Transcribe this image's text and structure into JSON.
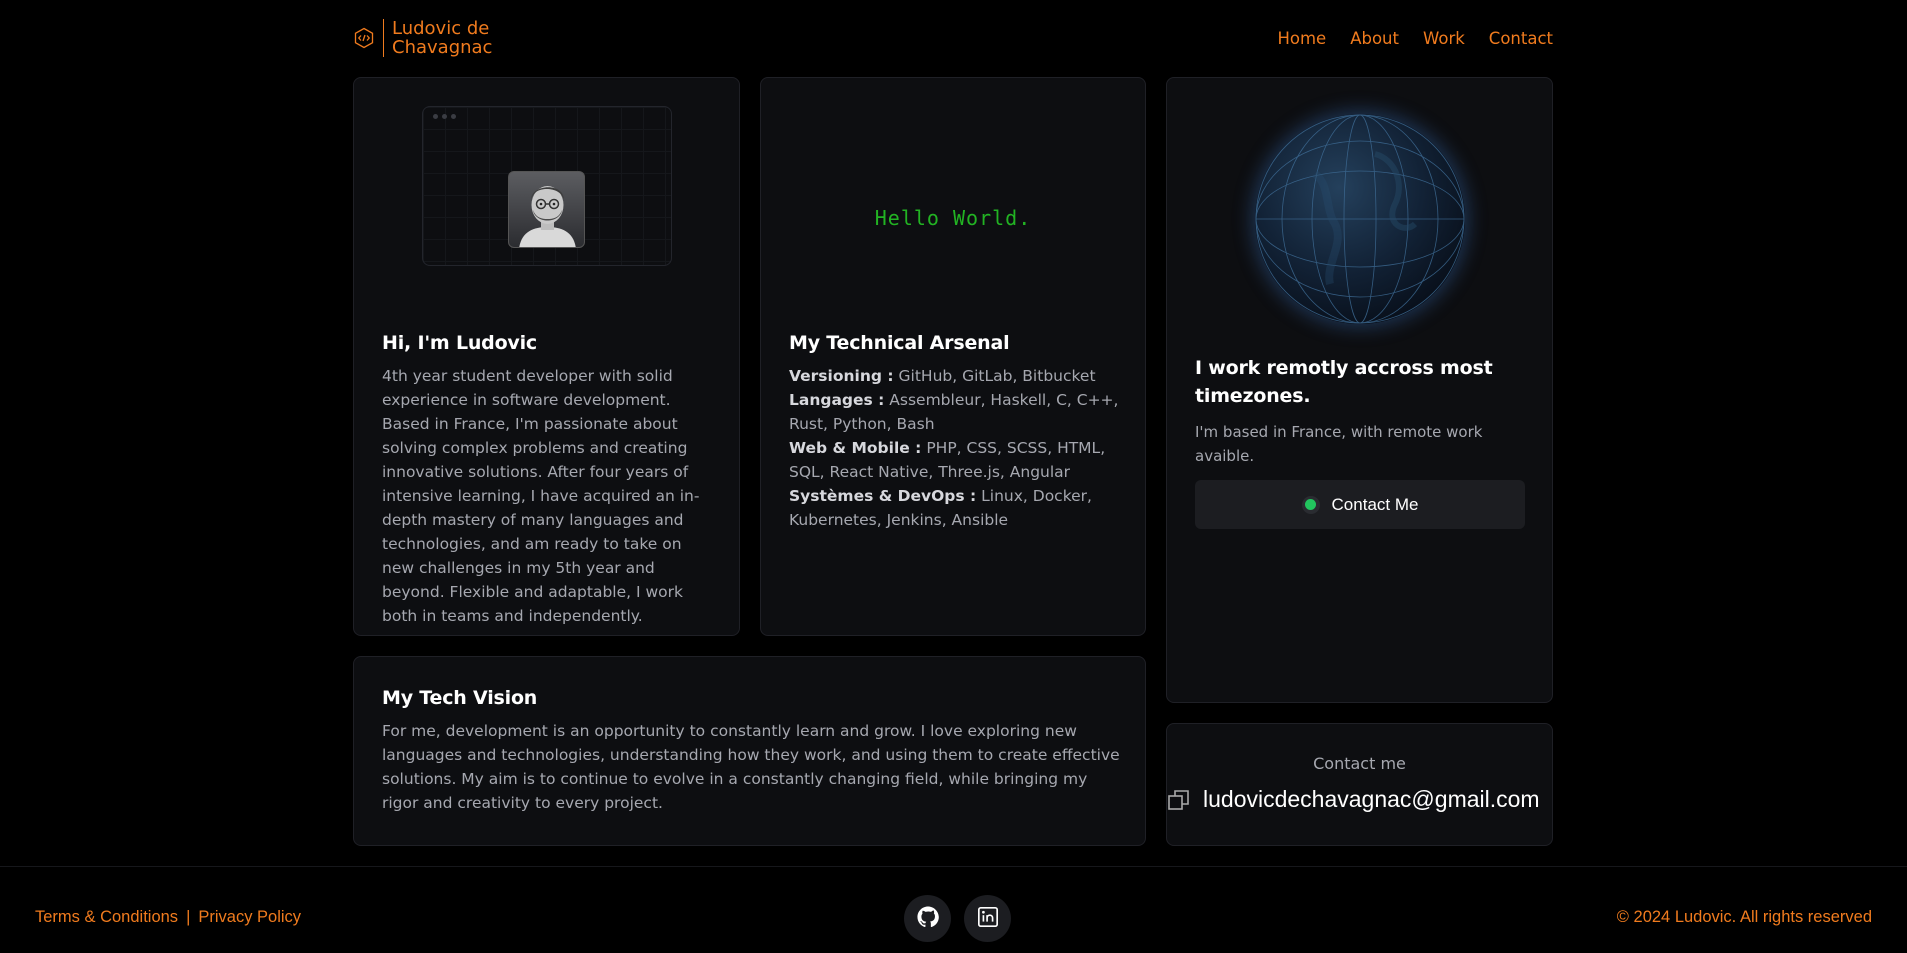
{
  "brand": {
    "name_line1": "Ludovic de",
    "name_line2": "Chavagnac"
  },
  "nav": {
    "items": [
      "Home",
      "About",
      "Work",
      "Contact"
    ]
  },
  "about": {
    "title": "Hi, I'm Ludovic",
    "text": "4th year student developer with solid experience in software development. Based in France, I'm passionate about solving complex problems and creating innovative solutions. After four years of intensive learning, I have acquired an in-depth mastery of many languages and technologies, and am ready to take on new challenges in my 5th year and beyond. Flexible and adaptable, I work both in teams and independently."
  },
  "arsenal": {
    "hello": "Hello World.",
    "title": "My Technical Arsenal",
    "items": [
      {
        "label": "Versioning :",
        "value": "GitHub, GitLab, Bitbucket"
      },
      {
        "label": "Langages :",
        "value": "Assembleur, Haskell, C, C++, Rust, Python, Bash"
      },
      {
        "label": "Web & Mobile :",
        "value": "PHP, CSS, SCSS, HTML, SQL, React Native, Three.js, Angular"
      },
      {
        "label": "Systèmes & DevOps :",
        "value": "Linux, Docker, Kubernetes, Jenkins, Ansible"
      }
    ]
  },
  "remote": {
    "title": "I work remotly accross most timezones.",
    "text": "I'm based in France, with remote work avaible.",
    "button": "Contact Me",
    "status_color": "#22c55e"
  },
  "vision": {
    "title": "My Tech Vision",
    "text": "For me, development is an opportunity to constantly learn and grow. I love exploring new languages and technologies, understanding how they work, and using them to create effective solutions. My aim is to continue to evolve in a constantly changing field, while bringing my rigor and creativity to every project."
  },
  "contact": {
    "label": "Contact me",
    "email": "ludovicdechavagnac@gmail.com"
  },
  "footer": {
    "terms": "Terms & Conditions",
    "separator": "|",
    "privacy": "Privacy Policy",
    "copyright": "© 2024 Ludovic. All rights reserved",
    "socials": [
      "github-icon",
      "linkedin-icon"
    ]
  },
  "colors": {
    "accent": "#f07b1e",
    "background": "#000000",
    "card": "#0d0e11",
    "terminal_green": "#22b323"
  }
}
